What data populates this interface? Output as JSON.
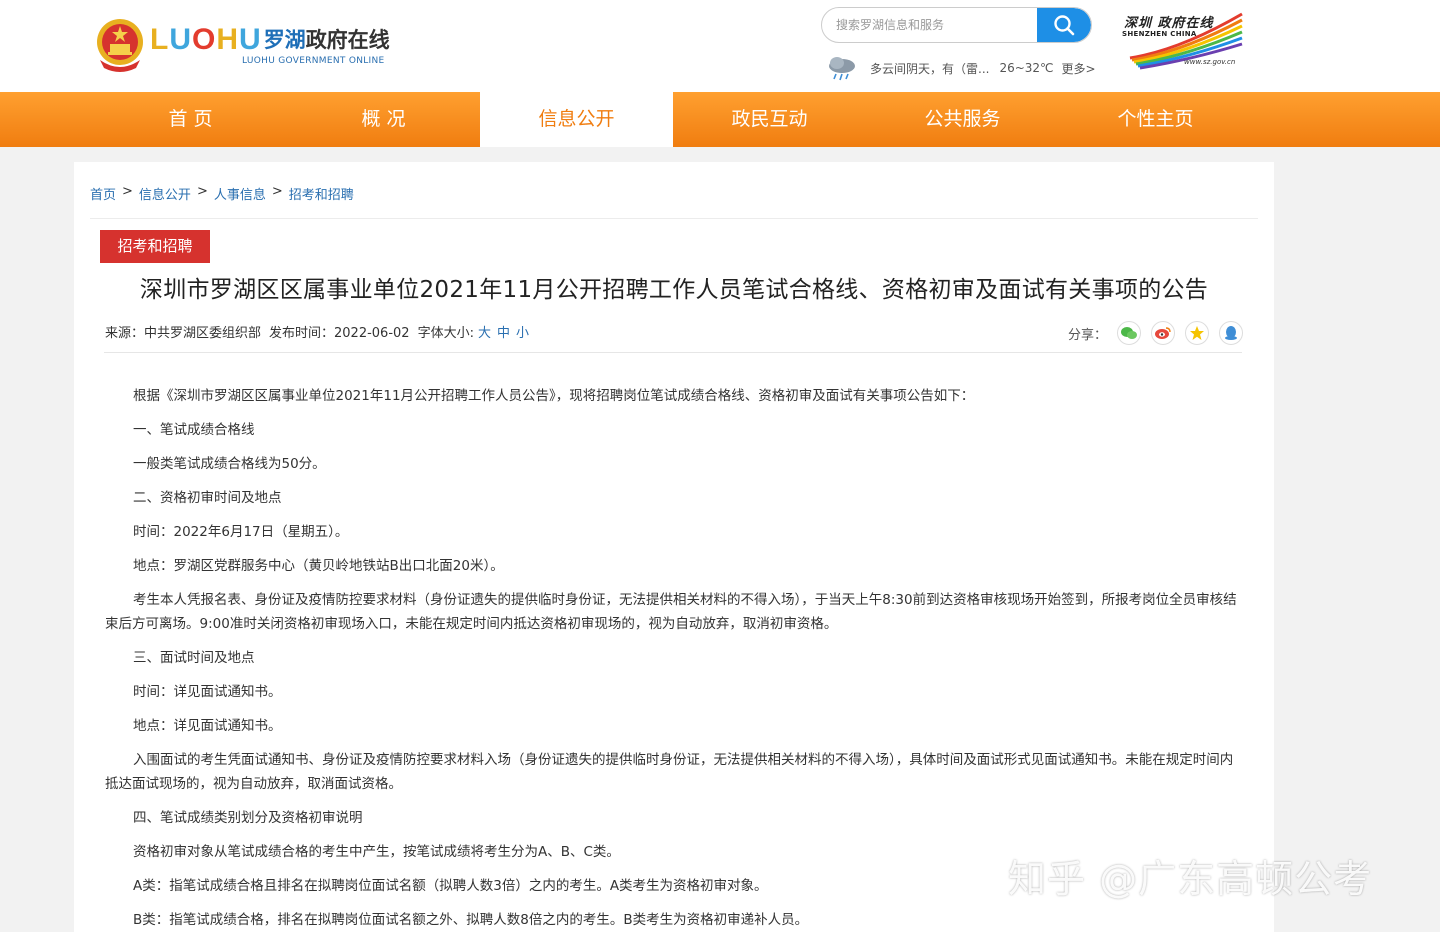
{
  "header": {
    "logo": {
      "luohu_en": [
        "L",
        "U",
        "O",
        "H",
        "U"
      ],
      "luohu_text": "LUOHU",
      "name_blue": "罗湖",
      "name_dark": "政府在线",
      "subtitle": "LUOHU GOVERNMENT ONLINE"
    },
    "search": {
      "placeholder": "搜索罗湖信息和服务"
    },
    "weather": {
      "icon": "cloud-rain-icon",
      "desc": "多云间阴天，有（雷...",
      "temp": "26~32℃",
      "more": "更多>"
    },
    "sz_logo": {
      "cn": "深圳 政府在线",
      "en": "SHENZHEN CHINA",
      "url": "www.sz.gov.cn"
    }
  },
  "nav": {
    "items": [
      {
        "label": "首 页"
      },
      {
        "label": "概 况"
      },
      {
        "label": "信息公开"
      },
      {
        "label": "政民互动"
      },
      {
        "label": "公共服务"
      },
      {
        "label": "个性主页"
      }
    ],
    "active_index": 2
  },
  "breadcrumb": {
    "items": [
      "首页",
      "信息公开",
      "人事信息",
      "招考和招聘"
    ],
    "sep": ">"
  },
  "article": {
    "tag": "招考和招聘",
    "title": "深圳市罗湖区区属事业单位2021年11月公开招聘工作人员笔试合格线、资格初审及面试有关事项的公告",
    "source": "来源：中共罗湖区委组织部",
    "date": "发布时间：2022-06-02",
    "font_size_label": "字体大小:",
    "font_sizes": [
      "大",
      "中",
      "小"
    ],
    "share_label": "分享：",
    "share_icons": [
      "wechat-icon",
      "weibo-icon",
      "favorite-star-icon",
      "qq-icon"
    ],
    "paragraphs": [
      "根据《深圳市罗湖区区属事业单位2021年11月公开招聘工作人员公告》，现将招聘岗位笔试成绩合格线、资格初审及面试有关事项公告如下：",
      "一、笔试成绩合格线",
      "一般类笔试成绩合格线为50分。",
      "二、资格初审时间及地点",
      "时间：2022年6月17日（星期五）。",
      "地点：罗湖区党群服务中心（黄贝岭地铁站B出口北面20米）。",
      "考生本人凭报名表、身份证及疫情防控要求材料（身份证遗失的提供临时身份证，无法提供相关材料的不得入场），于当天上午8:30前到达资格审核现场开始签到，所报考岗位全员审核结束后方可离场。9:00准时关闭资格初审现场入口，未能在规定时间内抵达资格初审现场的，视为自动放弃，取消初审资格。",
      "三、面试时间及地点",
      "时间：详见面试通知书。",
      "地点：详见面试通知书。",
      "入围面试的考生凭面试通知书、身份证及疫情防控要求材料入场（身份证遗失的提供临时身份证，无法提供相关材料的不得入场），具体时间及面试形式见面试通知书。未能在规定时间内抵达面试现场的，视为自动放弃，取消面试资格。",
      "四、笔试成绩类别划分及资格初审说明",
      "资格初审对象从笔试成绩合格的考生中产生，按笔试成绩将考生分为A、B、C类。",
      "A类：指笔试成绩合格且排名在拟聘岗位面试名额（拟聘人数3倍）之内的考生。A类考生为资格初审对象。",
      "B类：指笔试成绩合格，排名在拟聘岗位面试名额之外、拟聘人数8倍之内的考生。B类考生为资格初审递补人员。"
    ]
  },
  "watermark": "知乎 @广东高顿公考",
  "colors": {
    "nav_orange": "#f07d10",
    "tag_red": "#d6322e",
    "link_blue": "#2a6fb0",
    "search_blue": "#1e8fe6"
  }
}
